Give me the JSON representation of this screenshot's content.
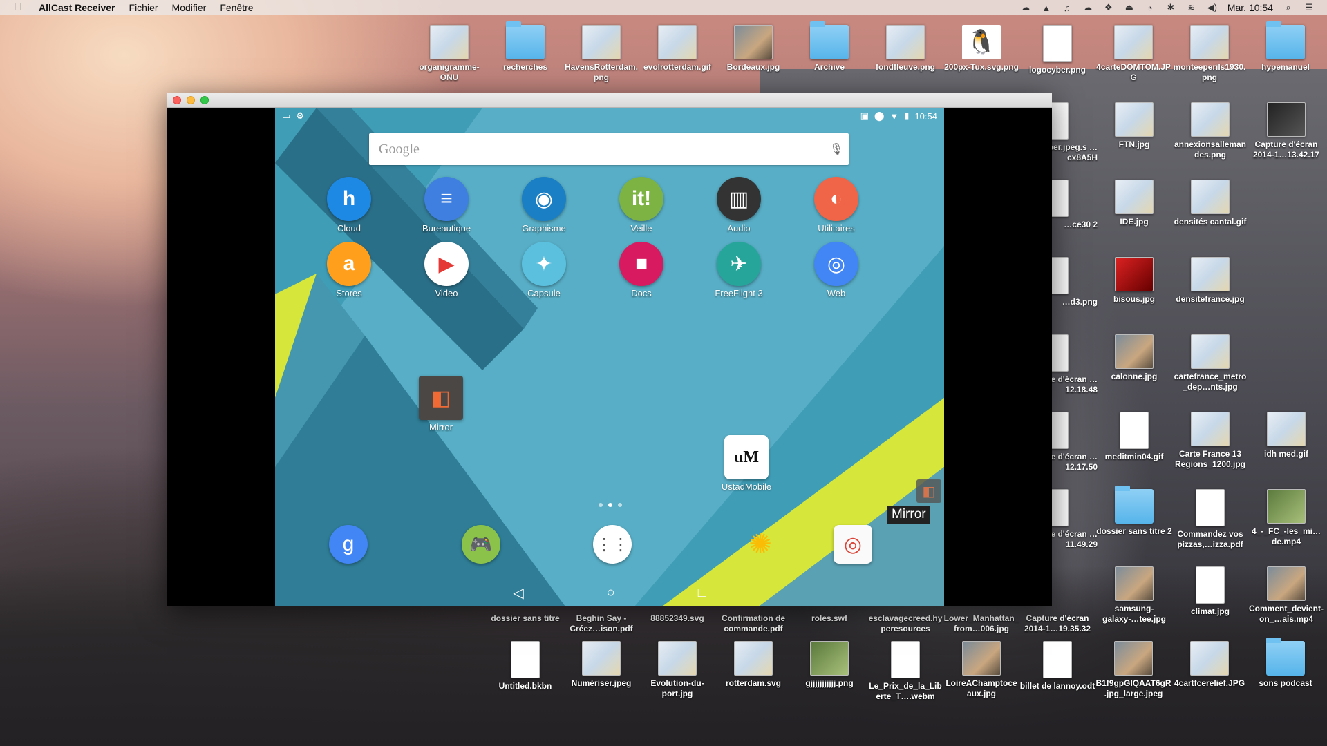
{
  "menubar": {
    "apple_icon": "apple-icon",
    "app_name": "AllCast Receiver",
    "menus": [
      "Fichier",
      "Modifier",
      "Fenêtre"
    ],
    "clock": "Mar. 10:54"
  },
  "desktop_top": [
    {
      "label": "organigramme-ONU",
      "kind": "map"
    },
    {
      "label": "recherches",
      "kind": "folder"
    },
    {
      "label": "HavensRotterdam.png",
      "kind": "map"
    },
    {
      "label": "evolrotterdam.gif",
      "kind": "map"
    },
    {
      "label": "Bordeaux.jpg",
      "kind": "photo"
    },
    {
      "label": "Archive",
      "kind": "folder"
    },
    {
      "label": "fondfleuve.png",
      "kind": "map"
    },
    {
      "label": "200px-Tux.svg.png",
      "kind": "tux"
    },
    {
      "label": "logocyber.png",
      "kind": "doc"
    },
    {
      "label": "4carteDOMTOM.JPG",
      "kind": "map"
    },
    {
      "label": "monteeperils1930.png",
      "kind": "map"
    },
    {
      "label": "hypemanuel",
      "kind": "folder"
    }
  ],
  "desktop_right_col1": [
    {
      "label": "…ber.jpeg.s …cx8A5H"
    },
    {
      "label": "…ce30 2"
    },
    {
      "label": "…d3.png"
    },
    {
      "label": "…e d'écran …12.18.48"
    },
    {
      "label": "…e d'écran …12.17.50"
    },
    {
      "label": "…e d'écran …11.49.29"
    }
  ],
  "desktop_right_col2": [
    {
      "label": "FTN.jpg",
      "kind": "map"
    },
    {
      "label": "IDE.jpg",
      "kind": "map"
    },
    {
      "label": "bisous.jpg",
      "kind": "red"
    },
    {
      "label": "calonne.jpg",
      "kind": "photo"
    },
    {
      "label": "meditmin04.gif",
      "kind": "doc"
    },
    {
      "label": "dossier sans titre 2",
      "kind": "folder"
    },
    {
      "label": "samsung-galaxy-…tee.jpg",
      "kind": "photo"
    }
  ],
  "desktop_right_col3": [
    {
      "label": "annexionsallemandes.png",
      "kind": "map"
    },
    {
      "label": "densités cantal.gif",
      "kind": "map"
    },
    {
      "label": "densitefrance.jpg",
      "kind": "map"
    },
    {
      "label": "cartefrance_metro_dep…nts.jpg",
      "kind": "map"
    },
    {
      "label": "Carte France 13 Regions_1200.jpg",
      "kind": "map"
    },
    {
      "label": "Commandez vos pizzas,…izza.pdf",
      "kind": "doc"
    },
    {
      "label": "climat.jpg",
      "kind": "doc"
    }
  ],
  "desktop_right_col4": [
    {
      "label": "Capture d'écran 2014-1…13.42.17",
      "kind": "dark"
    },
    {
      "label": "idh med.gif",
      "kind": "map"
    },
    {
      "label": "4_-_FC_-les_mi…de.mp4",
      "kind": "green"
    },
    {
      "label": "Comment_devient-on_…ais.mp4",
      "kind": "photo"
    }
  ],
  "desktop_bottom_labels": [
    "dossier sans titre",
    "Beghin Say - Créez…ison.pdf",
    "88852349.svg",
    "Confirmation de commande.pdf",
    "roles.swf",
    "esclavagecreed.hyperesources",
    "Lower_Manhattan_from…006.jpg",
    "Capture d'écran 2014-1…19.35.32"
  ],
  "desktop_bottom": [
    {
      "label": "Untitled.bkbn",
      "kind": "doc"
    },
    {
      "label": "Numériser.jpeg",
      "kind": "map"
    },
    {
      "label": "Evolution-du-port.jpg",
      "kind": "map"
    },
    {
      "label": "rotterdam.svg",
      "kind": "map"
    },
    {
      "label": "gjjjjjjjjjjj.png",
      "kind": "green"
    },
    {
      "label": "Le_Prix_de_la_Liberte_T….webm",
      "kind": "doc"
    },
    {
      "label": "LoireAChamptoceaux.jpg",
      "kind": "photo"
    },
    {
      "label": "billet de lannoy.odt",
      "kind": "doc"
    },
    {
      "label": "B1f9gpGIQAAT6gR.jpg_large.jpeg",
      "kind": "photo"
    },
    {
      "label": "4cartfcerelief.JPG",
      "kind": "map"
    },
    {
      "label": "sons podcast",
      "kind": "folder"
    }
  ],
  "android": {
    "status_time": "10:54",
    "search_placeholder": "Google",
    "apps_row1": [
      {
        "label": "Cloud",
        "icon": "cloud-folder-icon",
        "color": "#1e88e5",
        "glyph": "h"
      },
      {
        "label": "Bureautique",
        "icon": "docs-icon",
        "color": "#3f7fe0",
        "glyph": "≡"
      },
      {
        "label": "Graphisme",
        "icon": "camera-icon",
        "color": "#1a7fc4",
        "glyph": "◉"
      },
      {
        "label": "Veille",
        "icon": "it-icon",
        "color": "#7cb342",
        "glyph": "it!"
      },
      {
        "label": "Audio",
        "icon": "audio-icon",
        "color": "#333333",
        "glyph": "▥"
      },
      {
        "label": "Utilitaires",
        "icon": "utilities-icon",
        "color": "#f06548",
        "glyph": "◐"
      }
    ],
    "apps_row2": [
      {
        "label": "Stores",
        "icon": "amazon-apps-icon",
        "color": "#ff9f1c",
        "glyph": "a"
      },
      {
        "label": "Video",
        "icon": "video-icon",
        "color": "#ffffff",
        "glyph": "▶"
      },
      {
        "label": "Capsule",
        "icon": "capsule-icon",
        "color": "#5bc0de",
        "glyph": "✦"
      },
      {
        "label": "Docs",
        "icon": "docs-color-icon",
        "color": "#d81b60",
        "glyph": "■"
      },
      {
        "label": "FreeFlight 3",
        "icon": "drone-icon",
        "color": "#26a69a",
        "glyph": "✈"
      },
      {
        "label": "Web",
        "icon": "chrome-icon",
        "color": "#4285f4",
        "glyph": "◎"
      }
    ],
    "mirror_label": "Mirror",
    "ustad_label": "UstadMobile",
    "tooltip": "Mirror",
    "colors": {
      "bg": "#4aa3bd",
      "dark": "#2b6f87",
      "yellow": "#d7e63b"
    }
  }
}
